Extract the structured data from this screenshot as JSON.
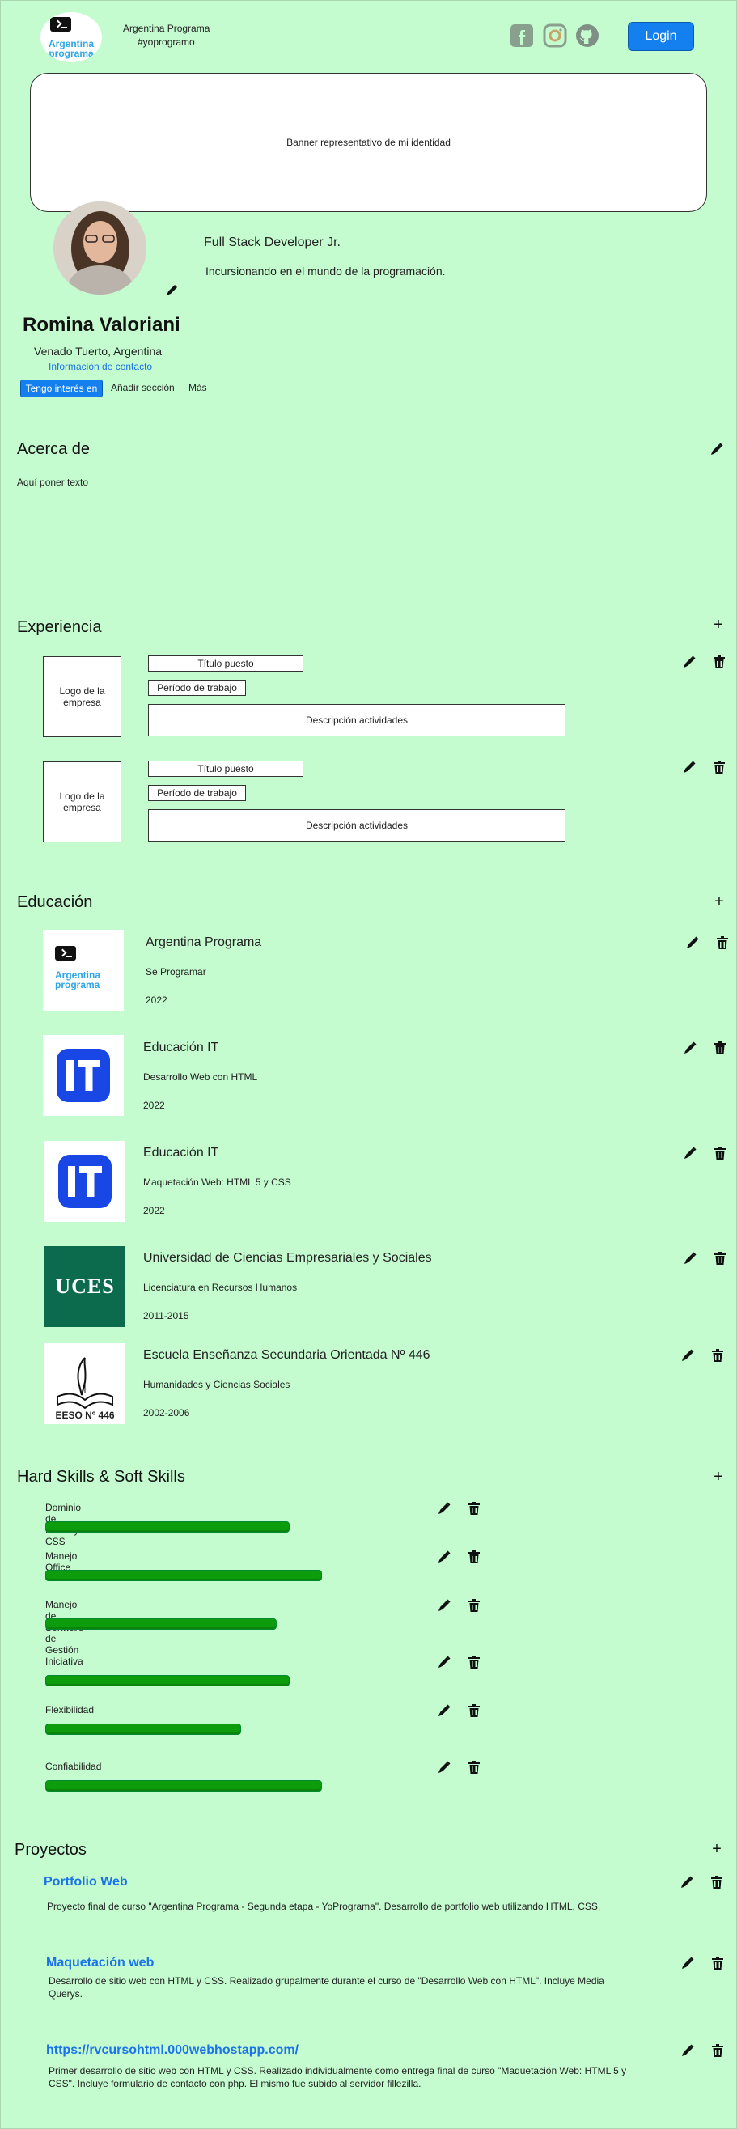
{
  "header": {
    "brand_title": "Argentina Programa",
    "brand_subtitle": "#yoprogramo",
    "logo_text_line1": "Argentina",
    "logo_text_line2": "programa",
    "login_label": "Login",
    "social_icons": [
      "facebook-icon",
      "instagram-icon",
      "github-icon"
    ]
  },
  "banner": {
    "text": "Banner representativo de mi identidad"
  },
  "profile": {
    "headline": "Full Stack Developer Jr.",
    "tagline": "Incursionando en el mundo de la programación.",
    "name": "Romina Valoriani",
    "location": "Venado Tuerto, Argentina",
    "contact_link": "Información de contacto",
    "interest_button": "Tengo interés en",
    "add_section": "Añadir sección",
    "more": "Más"
  },
  "about": {
    "title": "Acerca de",
    "text": "Aquí poner texto"
  },
  "experience": {
    "title": "Experiencia",
    "items": [
      {
        "logo": "Logo de la empresa",
        "position": "Título puesto",
        "period": "Período de trabajo",
        "description": "Descripción actividades"
      },
      {
        "logo": "Logo de la empresa",
        "position": "Título puesto",
        "period": "Período de trabajo",
        "description": "Descripción actividades"
      }
    ]
  },
  "education": {
    "title": "Educación",
    "items": [
      {
        "institution": "Argentina Programa",
        "degree": "Se Programar",
        "years": "2022",
        "logo": "argentina-programa-logo"
      },
      {
        "institution": "Educación IT",
        "degree": "Desarrollo Web con HTML",
        "years": "2022",
        "logo": "educacion-it-logo"
      },
      {
        "institution": "Educación IT",
        "degree": "Maquetación Web: HTML 5 y CSS",
        "years": "2022",
        "logo": "educacion-it-logo"
      },
      {
        "institution": "Universidad de Ciencias Empresariales y Sociales",
        "degree": "Licenciatura en Recursos Humanos",
        "years": "2011-2015",
        "logo": "uces-logo",
        "logo_text": "UCES"
      },
      {
        "institution": "Escuela Enseñanza Secundaria Orientada Nº 446",
        "degree": "Humanidades y Ciencias Sociales",
        "years": "2002-2006",
        "logo": "eeso-446-logo",
        "logo_text": "EESO Nº 446"
      }
    ]
  },
  "skills": {
    "title": "Hard Skills & Soft Skills",
    "items": [
      {
        "name": "Dominio de HTML y CSS",
        "level": 0.75
      },
      {
        "name": "Manejo Office",
        "level": 0.85
      },
      {
        "name": "Manejo de Software de Gestión",
        "level": 0.71
      },
      {
        "name": "Iniciativa",
        "level": 0.75
      },
      {
        "name": "Flexibilidad",
        "level": 0.6
      },
      {
        "name": "Confiabilidad",
        "level": 0.85
      }
    ]
  },
  "projects": {
    "title": "Proyectos",
    "items": [
      {
        "title": "Portfolio Web",
        "description": "Proyecto final de curso \"Argentina Programa - Segunda etapa - YoPrograma\". Desarrollo de portfolio web utilizando HTML, CSS,"
      },
      {
        "title": "Maquetación web",
        "description": "Desarrollo de sitio web con HTML y CSS. Realizado grupalmente durante el curso de  \"Desarrollo Web con HTML\". Incluye Media Querys."
      },
      {
        "title": "https://rvcursohtml.000webhostapp.com/",
        "description": "Primer desarrollo de sitio web con HTML y CSS. Realizado individualmente como entrega final de curso \"Maquetación Web: HTML 5 y CSS\". Incluye formulario de contacto con php. El mismo fue subido al servidor fillezilla."
      }
    ]
  },
  "colors": {
    "background": "#c4fccf",
    "accent": "#1480f0",
    "skill_bar": "#0c9c0c",
    "link": "#1a73e8"
  }
}
